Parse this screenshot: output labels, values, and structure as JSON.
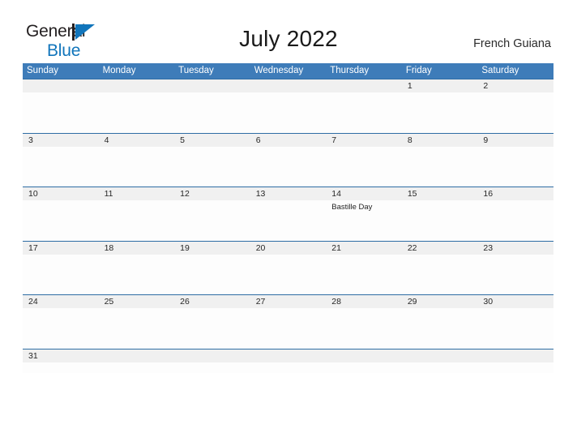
{
  "brand": {
    "name_part1": "General",
    "name_part2": "Blue",
    "mark": "triangle-flag",
    "color_primary": "#1175bb",
    "color_text": "#231f20"
  },
  "header": {
    "title": "July 2022",
    "region": "French Guiana"
  },
  "calendar": {
    "month": "July",
    "year": "2022",
    "header_bg": "#3e7cb9",
    "row_line_color": "#2e6da4",
    "band_bg": "#f0f0f0",
    "weekdays": [
      "Sunday",
      "Monday",
      "Tuesday",
      "Wednesday",
      "Thursday",
      "Friday",
      "Saturday"
    ],
    "weeks": [
      [
        {
          "day": ""
        },
        {
          "day": ""
        },
        {
          "day": ""
        },
        {
          "day": ""
        },
        {
          "day": ""
        },
        {
          "day": "1"
        },
        {
          "day": "2"
        }
      ],
      [
        {
          "day": "3"
        },
        {
          "day": "4"
        },
        {
          "day": "5"
        },
        {
          "day": "6"
        },
        {
          "day": "7"
        },
        {
          "day": "8"
        },
        {
          "day": "9"
        }
      ],
      [
        {
          "day": "10"
        },
        {
          "day": "11"
        },
        {
          "day": "12"
        },
        {
          "day": "13"
        },
        {
          "day": "14",
          "event": "Bastille Day"
        },
        {
          "day": "15"
        },
        {
          "day": "16"
        }
      ],
      [
        {
          "day": "17"
        },
        {
          "day": "18"
        },
        {
          "day": "19"
        },
        {
          "day": "20"
        },
        {
          "day": "21"
        },
        {
          "day": "22"
        },
        {
          "day": "23"
        }
      ],
      [
        {
          "day": "24"
        },
        {
          "day": "25"
        },
        {
          "day": "26"
        },
        {
          "day": "27"
        },
        {
          "day": "28"
        },
        {
          "day": "29"
        },
        {
          "day": "30"
        }
      ],
      [
        {
          "day": "31"
        },
        {
          "day": ""
        },
        {
          "day": ""
        },
        {
          "day": ""
        },
        {
          "day": ""
        },
        {
          "day": ""
        },
        {
          "day": ""
        }
      ]
    ]
  }
}
